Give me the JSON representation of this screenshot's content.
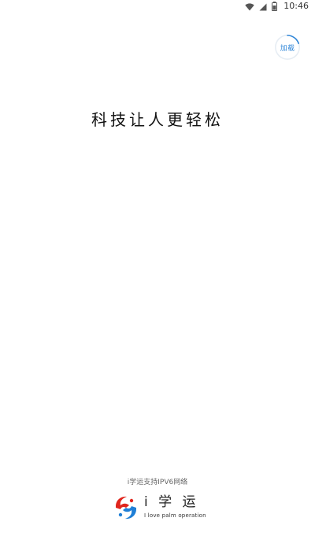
{
  "status_bar": {
    "time": "10:46",
    "icons": [
      "wifi-icon",
      "signal-icon",
      "battery-icon"
    ]
  },
  "loading_badge": {
    "label": "加载"
  },
  "splash": {
    "slogan": "科技让人更轻松"
  },
  "footer": {
    "network_note": "i学运支持IPV6网络",
    "brand_name": "i 学 运",
    "brand_tagline": "I love palm operation"
  },
  "colors": {
    "background": "#ffffff",
    "accent_blue": "#2f86d8",
    "logo_red": "#e0261d",
    "logo_blue": "#1f7fd6"
  }
}
